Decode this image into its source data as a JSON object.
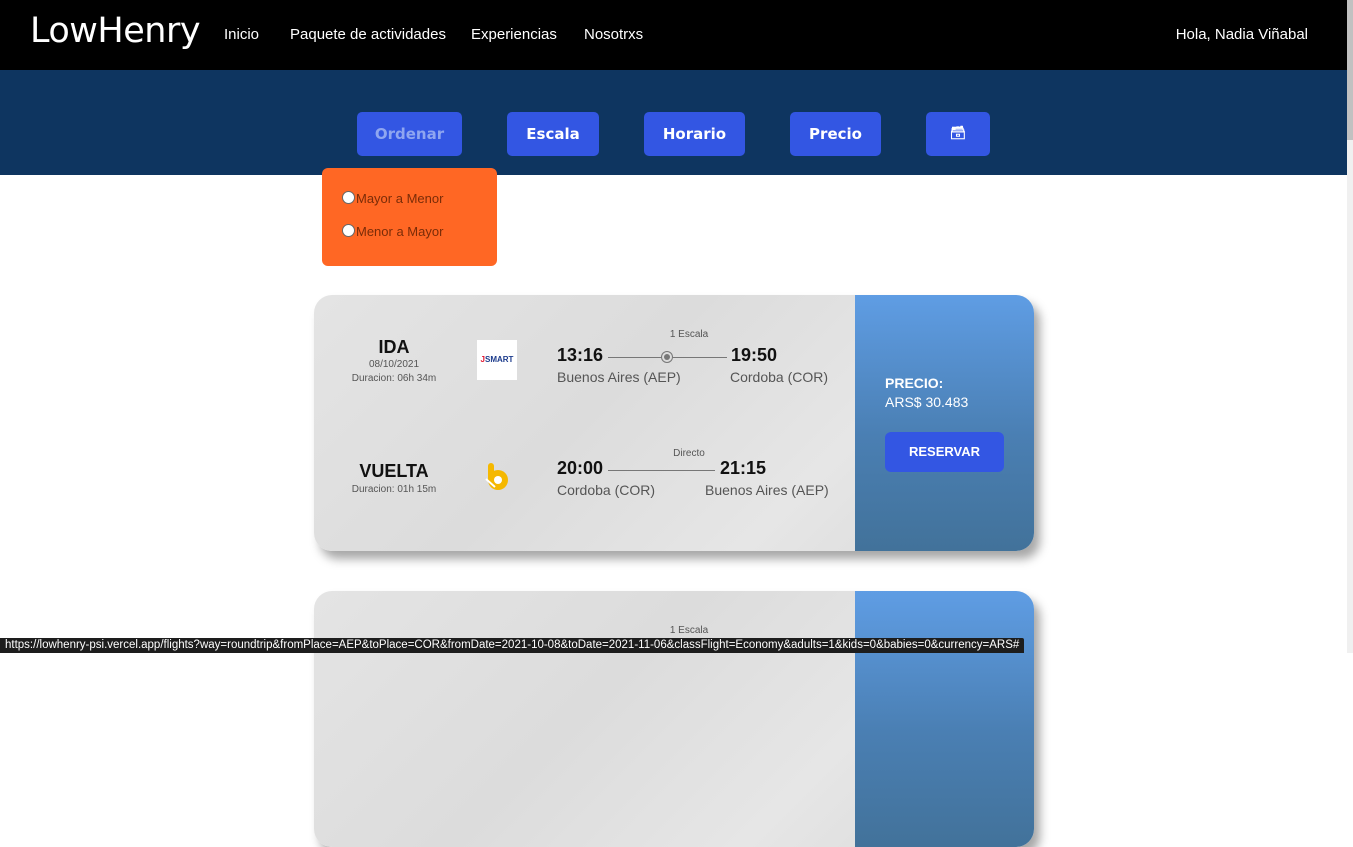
{
  "header": {
    "brand": "LowHenry",
    "nav": [
      "Inicio",
      "Paquete de actividades",
      "Experiencias",
      "Nosotrxs"
    ],
    "greeting": "Hola, Nadia Viñabal"
  },
  "filters": {
    "buttons": [
      "Ordenar",
      "Escala",
      "Horario",
      "Precio",
      "🗃"
    ],
    "active": "Ordenar",
    "sort_options": [
      "Mayor a Menor",
      "Menor a Mayor"
    ]
  },
  "flights": [
    {
      "outbound": {
        "label": "IDA",
        "date": "08/10/2021",
        "duration": "Duracion: 06h 34m",
        "airline_logo": "jetsmart-logo",
        "airline_text": "SMART",
        "stops": "1 Escala",
        "dep_time": "13:16",
        "arr_time": "19:50",
        "from": "Buenos Aires (AEP)",
        "to": "Cordoba (COR)"
      },
      "inbound": {
        "label": "VUELTA",
        "duration": "Duracion: 01h 15m",
        "airline_logo": "flybondi-logo",
        "stops": "Directo",
        "dep_time": "20:00",
        "arr_time": "21:15",
        "from": "Cordoba (COR)",
        "to": "Buenos Aires (AEP)"
      },
      "price_label": "PRECIO:",
      "price": "ARS$ 30.483",
      "reserve": "RESERVAR"
    },
    {
      "outbound": {
        "stops": "1 Escala"
      }
    }
  ],
  "status_url": "https://lowhenry-psi.vercel.app/flights?way=roundtrip&fromPlace=AEP&toPlace=COR&fromDate=2021-10-08&toDate=2021-11-06&classFlight=Economy&adults=1&kids=0&babies=0&currency=ARS#",
  "colors": {
    "nav_bg": "#000000",
    "filter_bg": "#0e3560",
    "button": "#3356e3",
    "dropdown": "#ff6724",
    "price_panel": "#4a7fb3"
  }
}
